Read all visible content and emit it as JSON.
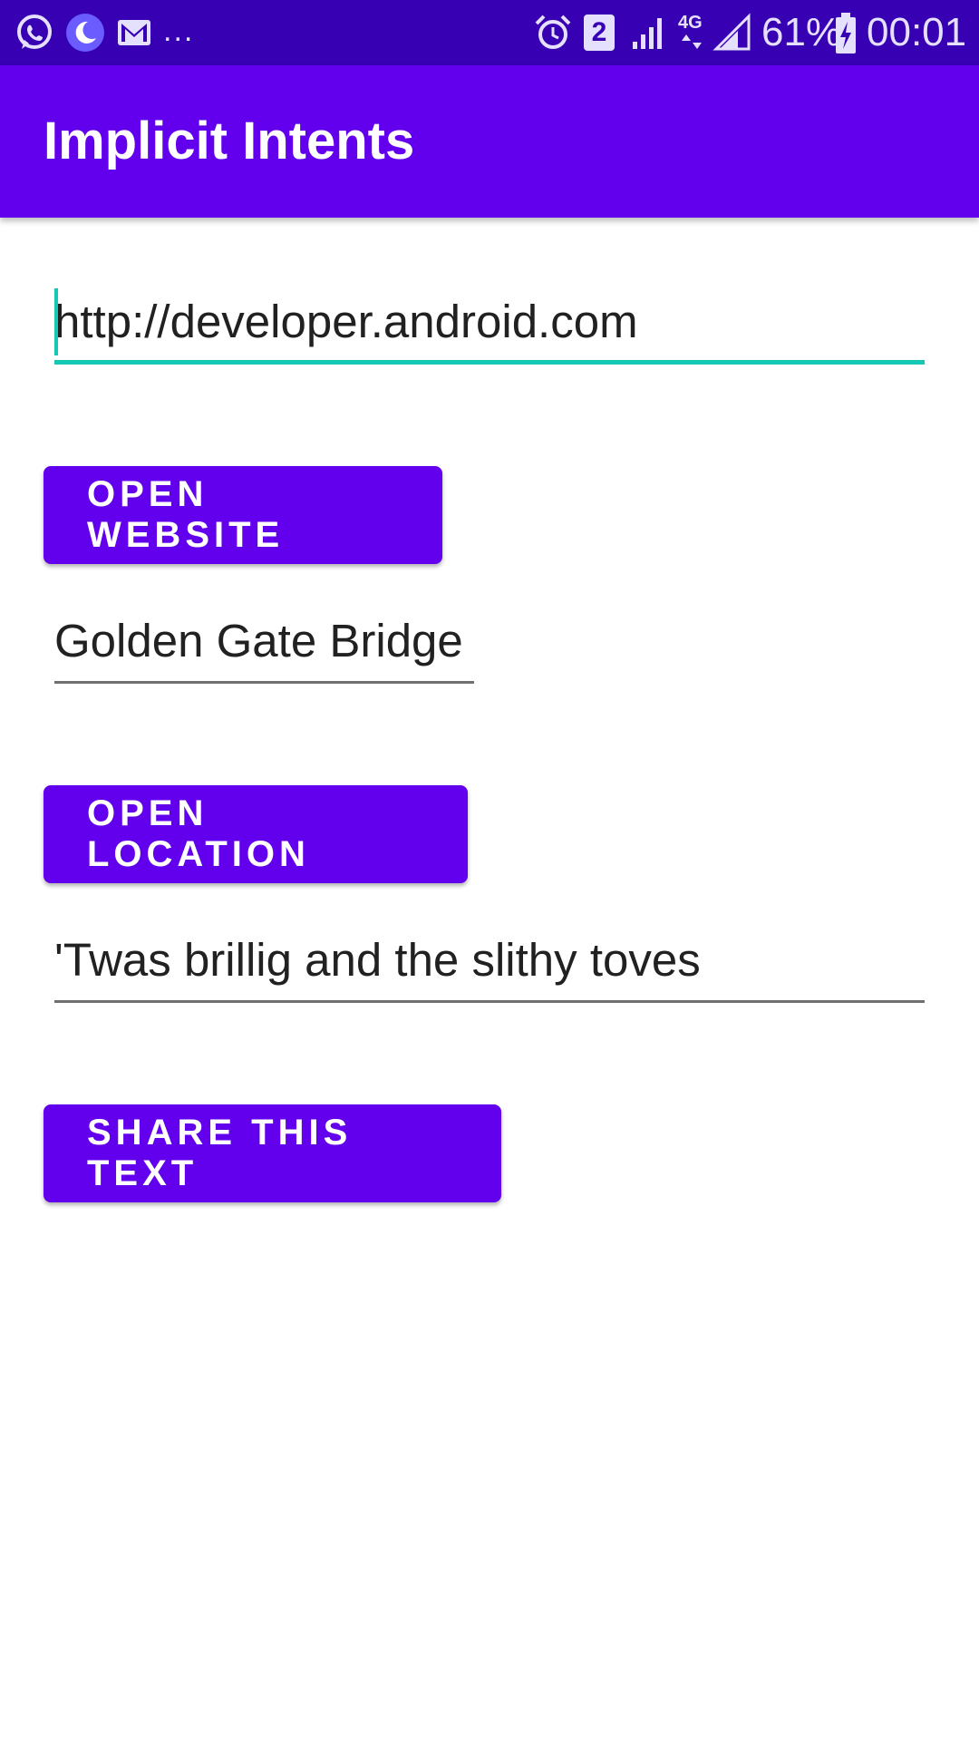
{
  "status_bar": {
    "left_icons": [
      "whatsapp-icon",
      "moon-app-icon",
      "gmail-icon"
    ],
    "more_indicator": "...",
    "sim_badge": "2",
    "network_label": "4G",
    "battery_percent": "61%",
    "time": "00:01",
    "background_color": "#3700b3"
  },
  "app_bar": {
    "title": "Implicit Intents",
    "background_color": "#6200ee"
  },
  "website": {
    "input_value": "http://developer.android.com",
    "button_label": "OPEN WEBSITE"
  },
  "location": {
    "input_value": "Golden Gate Bridge",
    "button_label": "OPEN LOCATION"
  },
  "share": {
    "input_value": "'Twas brillig and the slithy toves",
    "button_label": "SHARE THIS TEXT"
  },
  "colors": {
    "accent": "#14c8b4",
    "primary": "#6200ee",
    "primary_dark": "#3700b3"
  }
}
